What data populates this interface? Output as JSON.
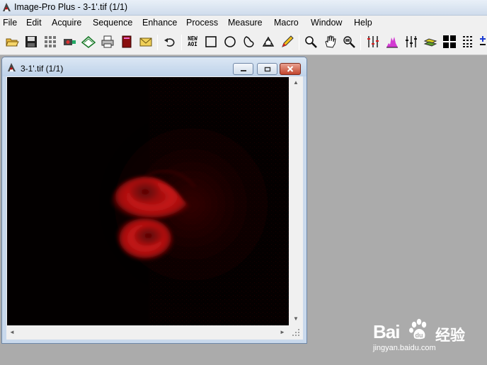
{
  "app": {
    "title": "Image-Pro Plus - 3-1'.tif (1/1)"
  },
  "menu": [
    "File",
    "Edit",
    "Acquire",
    "Sequence",
    "Enhance",
    "Process",
    "Measure",
    "Macro",
    "Window",
    "Help"
  ],
  "toolbar": {
    "new_aoi_line1": "NEW",
    "new_aoi_line2": "AOI",
    "buttons": [
      "open-folder-icon",
      "save-icon",
      "grid-icon",
      "camera-icon",
      "scanner-icon",
      "print-icon",
      "database-icon",
      "mail-icon",
      "undo-icon",
      "new-aoi-icon",
      "rectangle-aoi-icon",
      "ellipse-aoi-icon",
      "irregular-aoi-icon",
      "magic-wand-icon",
      "pencil-icon",
      "zoom-icon",
      "pan-hand-icon",
      "zoom-window-icon",
      "contrast-icon",
      "histogram-icon",
      "line-profile-icon",
      "layers-icon",
      "tiles-icon",
      "grid-pattern-icon",
      "plus-icon"
    ]
  },
  "image_window": {
    "title": "3-1'.tif (1/1)",
    "scrollbar_left_arrow": "◄",
    "scrollbar_right_arrow": "►",
    "scrollbar_up_arrow": "▲",
    "scrollbar_down_arrow": "▼"
  },
  "watermark": {
    "brand": "Bai",
    "product": "经验",
    "url": "jingyan.baidu.com"
  }
}
